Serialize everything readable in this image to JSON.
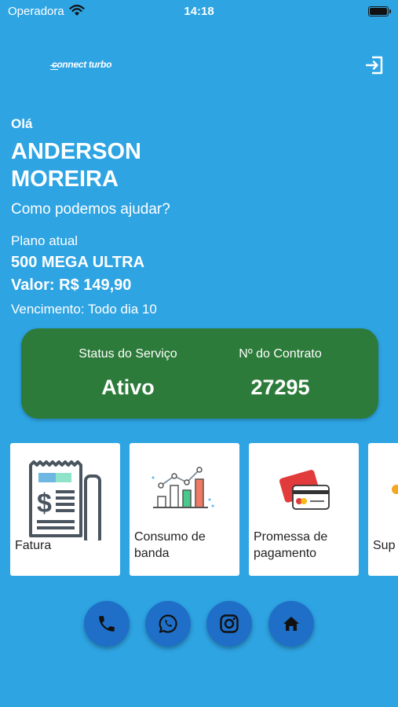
{
  "status_bar": {
    "carrier": "Operadora",
    "time": "14:18"
  },
  "header": {
    "logo_text": "connect turbo"
  },
  "greeting": {
    "hello": "Olá",
    "name": "ANDERSON MOREIRA",
    "prompt": "Como podemos ajudar?"
  },
  "plan": {
    "label": "Plano atual",
    "name": "500 MEGA ULTRA",
    "value": "Valor: R$ 149,90",
    "due": "Vencimento: Todo dia 10"
  },
  "service_card": {
    "status_label": "Status do Serviço",
    "status_value": "Ativo",
    "contract_label": "Nº do Contrato",
    "contract_value": "27295",
    "color": "#2d7b3a"
  },
  "tiles": [
    {
      "label": "Fatura",
      "icon": "invoice-icon"
    },
    {
      "label": "Consumo de banda",
      "icon": "bandwidth-chart-icon"
    },
    {
      "label": "Promessa de pagamento",
      "icon": "credit-card-icon"
    },
    {
      "label": "Sup",
      "icon": "support-icon"
    }
  ],
  "quick_actions": [
    {
      "icon": "phone-icon"
    },
    {
      "icon": "whatsapp-icon"
    },
    {
      "icon": "instagram-icon"
    },
    {
      "icon": "home-icon"
    }
  ],
  "colors": {
    "background": "#2ea4e3",
    "buttons": "#1f6fc8",
    "card": "#2d7b3a"
  }
}
